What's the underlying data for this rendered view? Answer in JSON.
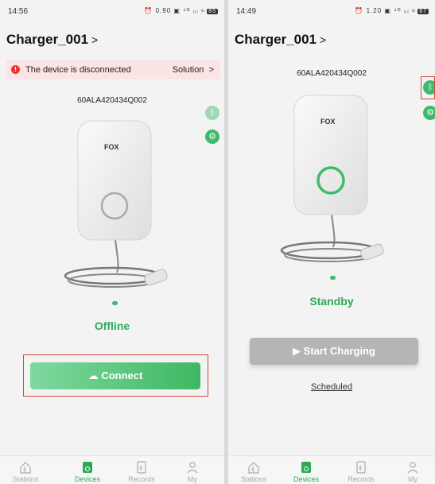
{
  "colors": {
    "accent": "#3dbb6d",
    "error": "#e53935",
    "banner_bg": "#fde4e4",
    "disabled": "#b5b5b5"
  },
  "left_screen": {
    "status_bar": {
      "time": "14:56",
      "icons": "⏰ 0.90 ▣ ⁴ᴳ ᵢᵢᵢ ≈",
      "battery": "85"
    },
    "header": {
      "title": "Charger_001",
      "chevron": ">"
    },
    "banner": {
      "icon": "!",
      "message": "The device is disconnected",
      "action": "Solution",
      "action_chevron": ">"
    },
    "serial": "60ALA420434Q002",
    "brand": "FOX",
    "side_buttons": {
      "bluetooth_icon": "bluetooth-icon",
      "settings_icon": "gear-icon"
    },
    "status": "Offline",
    "connect_button": {
      "icon": "cloud-check-icon",
      "label": "Connect"
    }
  },
  "right_screen": {
    "status_bar": {
      "time": "14:49",
      "icons": "⏰ 1.20 ▣ ⁴ᴳ ᵢᵢᵢ ≈",
      "battery": "87"
    },
    "header": {
      "title": "Charger_001",
      "chevron": ">"
    },
    "serial": "60ALA420434Q002",
    "brand": "FOX",
    "side_buttons": {
      "bluetooth_icon": "bluetooth-icon",
      "settings_icon": "gear-icon"
    },
    "status": "Standby",
    "start_button": {
      "icon": "play-icon",
      "label": "Start Charging"
    },
    "scheduled_link": "Scheduled"
  },
  "tabbar": {
    "items": [
      {
        "label": "Stations",
        "icon": "house-bolt-icon",
        "active": false
      },
      {
        "label": "Devices",
        "icon": "charger-icon",
        "active": true
      },
      {
        "label": "Records",
        "icon": "document-bolt-icon",
        "active": false
      },
      {
        "label": "My",
        "icon": "person-icon",
        "active": false
      }
    ]
  }
}
